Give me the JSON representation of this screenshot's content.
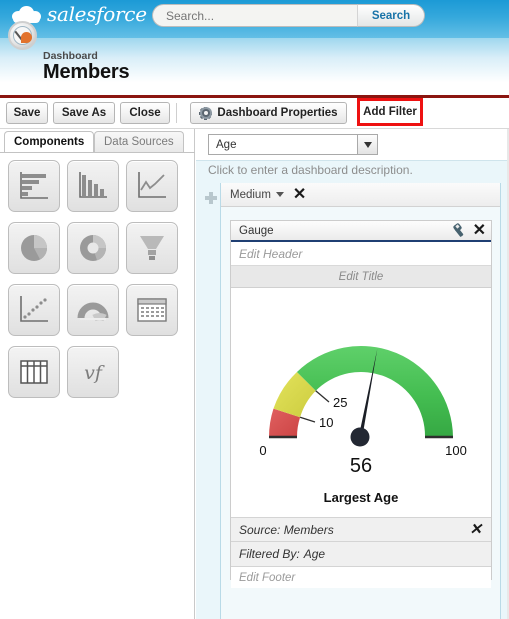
{
  "topbar": {
    "brand": "salesforce",
    "brand_icon": "cloud-icon",
    "search": {
      "placeholder": "Search...",
      "value": "",
      "button_label": "Search"
    }
  },
  "page_header": {
    "icon": "gauge-dashboard-icon",
    "kicker": "Dashboard",
    "title": "Members"
  },
  "toolbar": {
    "save_label": "Save",
    "save_as_label": "Save As",
    "close_label": "Close",
    "properties_label": "Dashboard Properties",
    "properties_icon": "gear-icon",
    "add_filter_label": "Add Filter",
    "highlight_color": "#ee1111"
  },
  "left_panel": {
    "tabs": [
      {
        "label": "Components",
        "active": true
      },
      {
        "label": "Data Sources",
        "active": false
      }
    ],
    "palette": [
      {
        "name": "horizontal-bar-chart",
        "label": "Horizontal Bar Chart"
      },
      {
        "name": "vertical-bar-chart",
        "label": "Vertical Bar Chart"
      },
      {
        "name": "line-chart",
        "label": "Line Chart"
      },
      {
        "name": "pie-chart",
        "label": "Pie Chart"
      },
      {
        "name": "donut-chart",
        "label": "Donut Chart"
      },
      {
        "name": "funnel-chart",
        "label": "Funnel Chart"
      },
      {
        "name": "scatter-chart",
        "label": "Scatter Chart"
      },
      {
        "name": "gauge-chart",
        "label": "Gauge"
      },
      {
        "name": "metric-table",
        "label": "Metric"
      },
      {
        "name": "table-component",
        "label": "Table"
      },
      {
        "name": "visualforce-page",
        "label": "Visualforce Page"
      }
    ]
  },
  "canvas": {
    "filter_select_value": "Age",
    "description_placeholder": "Click to enter a dashboard description.",
    "column": {
      "size_label": "Medium",
      "close_label": "✕"
    },
    "component": {
      "title": "Gauge",
      "settings_icon": "wrench-icon",
      "close_icon": "close-icon",
      "header_placeholder": "Edit Header",
      "title_placeholder": "Edit Title",
      "source_label": "Source: Members",
      "filtered_by_label": "Filtered By:",
      "filtered_by_value": "Age",
      "footer_placeholder": "Edit Footer"
    }
  },
  "chart_data": {
    "type": "gauge",
    "title": "Largest Age",
    "value": 56,
    "value_label": "56",
    "min": 0,
    "max": 100,
    "min_label": "0",
    "max_label": "100",
    "breakpoints": [
      10,
      25
    ],
    "breakpoint_labels": [
      "10",
      "25"
    ],
    "segments": [
      {
        "from": 0,
        "to": 10,
        "color": "#d9534f",
        "name": "low"
      },
      {
        "from": 10,
        "to": 25,
        "color": "#d6d64b",
        "name": "medium"
      },
      {
        "from": 25,
        "to": 100,
        "color": "#44bd51",
        "name": "high"
      }
    ],
    "needle_color": "#1b1f26",
    "xlabel": "",
    "ylabel": ""
  }
}
